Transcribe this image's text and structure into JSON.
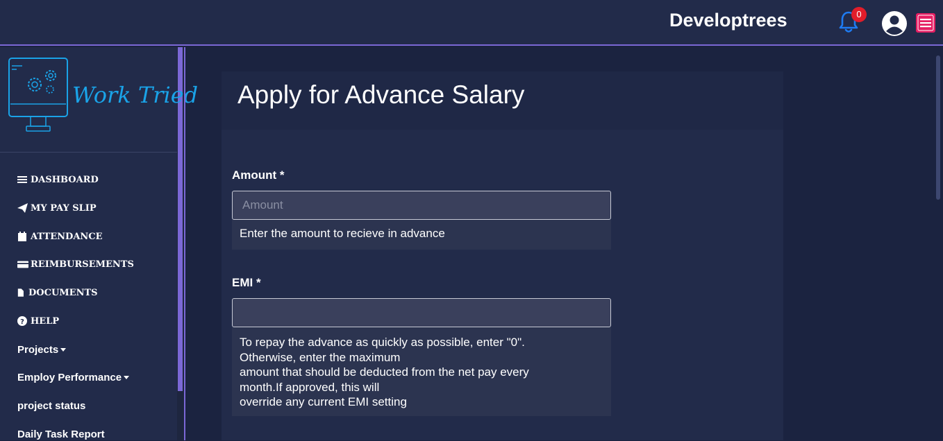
{
  "header": {
    "brand": "Developtrees",
    "notifications_count": "0"
  },
  "sidebar": {
    "logo_text": "Work Tried",
    "items": [
      {
        "label": "DASHBOARD",
        "icon": "bars-icon"
      },
      {
        "label": "MY PAY SLIP",
        "icon": "paper-plane-icon"
      },
      {
        "label": "ATTENDANCE",
        "icon": "calendar-icon"
      },
      {
        "label": "REIMBURSEMENTS",
        "icon": "credit-card-icon"
      },
      {
        "label": "DOCUMENTS",
        "icon": "file-icon"
      },
      {
        "label": "HELP",
        "icon": "question-circle-icon"
      },
      {
        "label": "Projects",
        "icon": "caret-down-icon"
      },
      {
        "label": "Employ Performance",
        "icon": "caret-down-icon"
      },
      {
        "label": "project status",
        "icon": ""
      },
      {
        "label": "Daily Task Report",
        "icon": ""
      }
    ]
  },
  "main": {
    "title": "Apply for Advance Salary",
    "amount": {
      "label": "Amount *",
      "placeholder": "Amount",
      "value": "",
      "help": "Enter the amount to recieve in advance"
    },
    "emi": {
      "label": "EMI *",
      "placeholder": "",
      "value": "",
      "help_lines": [
        "To repay the advance as quickly as possible, enter \"0\".",
        "Otherwise, enter the maximum",
        "amount that should be deducted from the net pay every",
        "month.If approved, this will",
        "override any current EMI setting"
      ]
    }
  },
  "colors": {
    "accent": "#7b68d6",
    "badge": "#e11d2a",
    "menu_button": "#e51e63",
    "bell": "#1e7bf2",
    "logo": "#1aa3e8"
  }
}
